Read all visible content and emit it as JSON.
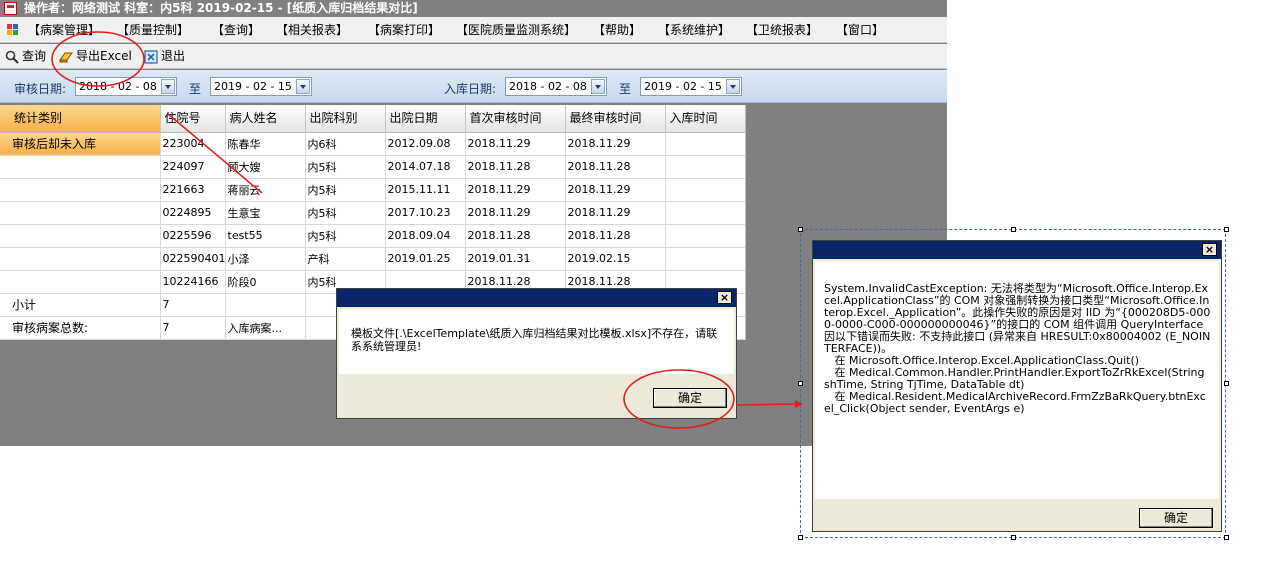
{
  "window": {
    "title": "操作者：网络测试   科室：内5科   2019-02-15  - [纸质入库归档结果对比]"
  },
  "menu": {
    "items": [
      "【病案管理】",
      "【质量控制】",
      "【查询】",
      "【相关报表】",
      "【病案打印】",
      "【医院质量监测系统】",
      "【帮助】",
      "【系统维护】",
      "【卫统报表】",
      "【窗口】"
    ]
  },
  "toolbar": {
    "query_label": "查询",
    "export_label": "导出Excel",
    "exit_label": "退出"
  },
  "filters": {
    "review_date_label": "审核日期:",
    "review_from": "2018 - 02 - 08",
    "to_label_1": "至",
    "review_to": "2019 - 02 - 15",
    "storage_date_label": "入库日期:",
    "storage_from": "2018 - 02 - 08",
    "to_label_2": "至",
    "storage_to": "2019 - 02 - 15"
  },
  "grid": {
    "headers": [
      "统计类别",
      "住院号",
      "病人姓名",
      "出院科别",
      "出院日期",
      "首次审核时间",
      "最终审核时间",
      "入库时间"
    ],
    "rows": [
      [
        "审核后却未入库",
        "223004",
        "陈春华",
        "内6科",
        "2012.09.08",
        "2018.11.29",
        "2018.11.29",
        ""
      ],
      [
        "",
        "224097",
        "顾大嫂",
        "内5科",
        "2014.07.18",
        "2018.11.28",
        "2018.11.28",
        ""
      ],
      [
        "",
        "221663",
        "蒋丽云",
        "内5科",
        "2015.11.11",
        "2018.11.29",
        "2018.11.29",
        ""
      ],
      [
        "",
        "0224895",
        "生意宝",
        "内5科",
        "2017.10.23",
        "2018.11.29",
        "2018.11.29",
        ""
      ],
      [
        "",
        "0225596",
        "test55",
        "内5科",
        "2018.09.04",
        "2018.11.28",
        "2018.11.28",
        ""
      ],
      [
        "",
        "022590401",
        "小泽",
        "产科",
        "2019.01.25",
        "2019.01.31",
        "2019.02.15",
        ""
      ],
      [
        "",
        "10224166",
        "阶段0",
        "内5科",
        "",
        "2018.11.28",
        "2018.11.28",
        ""
      ],
      [
        "小计",
        "7",
        "",
        "",
        "",
        "",
        "",
        ""
      ],
      [
        "审核病案总数:",
        "7",
        "入库病案...",
        "",
        "",
        "",
        "",
        ""
      ]
    ]
  },
  "dialog_template": {
    "message": "模板文件[.\\ExcelTemplate\\纸质入库归档结果对比模板.xlsx]不存在，请联系系统管理员!",
    "close": "×",
    "ok_label": "确定"
  },
  "dialog_exception": {
    "message": "System.InvalidCastException: 无法将类型为“Microsoft.Office.Interop.Excel.ApplicationClass”的 COM 对象强制转换为接口类型“Microsoft.Office.Interop.Excel._Application”。此操作失败的原因是对 IID 为“{000208D5-0000-0000-C000-000000000046}”的接口的 COM 组件调用 QueryInterface 因以下错误而失败: 不支持此接口 (异常来自 HRESULT:0x80004002 (E_NOINTERFACE))。\n   在 Microsoft.Office.Interop.Excel.ApplicationClass.Quit()\n   在 Medical.Common.Handler.PrintHandler.ExportToZrRkExcel(String shTime, String TjTime, DataTable dt)\n   在 Medical.Resident.MedicalArchiveRecord.FrmZzBaRkQuery.btnExcel_Click(Object sender, EventArgs e)",
    "close": "×",
    "ok_label": "确定"
  },
  "annotations": {
    "color": "#e02020"
  }
}
